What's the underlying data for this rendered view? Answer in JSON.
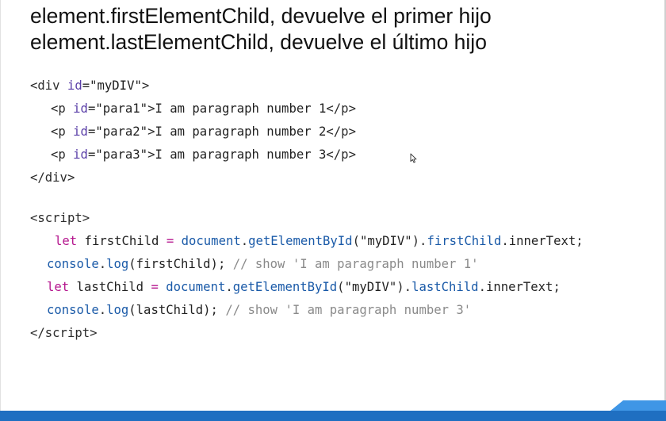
{
  "slide": {
    "title_lines": [
      "element.firstElementChild, devuelve el primer hijo",
      "element.lastElementChild, devuelve el último hijo"
    ]
  },
  "colors": {
    "punct": "#2b2b2b",
    "tag": "#2b2b2b",
    "attr": "#5a3fa8",
    "string": "#1f1f1f",
    "text": "#1f1f1f",
    "keyword": "#b5168e",
    "identifier": "#222222",
    "builtin": "#1a5aa8",
    "method": "#1a5aa8",
    "property": "#1a5aa8",
    "comment": "#8a8a8a",
    "bar": "#1f6fc1",
    "bar_accent": "#3f96e6"
  },
  "code_lines": [
    {
      "indent": 0,
      "tokens": [
        {
          "t": "<",
          "c": "punct"
        },
        {
          "t": "div",
          "c": "tag"
        },
        {
          "t": " ",
          "c": "text"
        },
        {
          "t": "id",
          "c": "attr"
        },
        {
          "t": "=",
          "c": "punct"
        },
        {
          "t": "\"myDIV\"",
          "c": "string"
        },
        {
          "t": ">",
          "c": "punct"
        }
      ]
    },
    {
      "indent": 1,
      "tokens": [
        {
          "t": "<",
          "c": "punct"
        },
        {
          "t": "p",
          "c": "tag"
        },
        {
          "t": " ",
          "c": "text"
        },
        {
          "t": "id",
          "c": "attr"
        },
        {
          "t": "=",
          "c": "punct"
        },
        {
          "t": "\"para1\"",
          "c": "string"
        },
        {
          "t": ">",
          "c": "punct"
        },
        {
          "t": "I am paragraph number 1",
          "c": "text"
        },
        {
          "t": "</",
          "c": "punct"
        },
        {
          "t": "p",
          "c": "tag"
        },
        {
          "t": ">",
          "c": "punct"
        }
      ]
    },
    {
      "indent": 1,
      "tokens": [
        {
          "t": "<",
          "c": "punct"
        },
        {
          "t": "p",
          "c": "tag"
        },
        {
          "t": " ",
          "c": "text"
        },
        {
          "t": "id",
          "c": "attr"
        },
        {
          "t": "=",
          "c": "punct"
        },
        {
          "t": "\"para2\"",
          "c": "string"
        },
        {
          "t": ">",
          "c": "punct"
        },
        {
          "t": "I am paragraph number 2",
          "c": "text"
        },
        {
          "t": "</",
          "c": "punct"
        },
        {
          "t": "p",
          "c": "tag"
        },
        {
          "t": ">",
          "c": "punct"
        }
      ]
    },
    {
      "indent": 1,
      "tokens": [
        {
          "t": "<",
          "c": "punct"
        },
        {
          "t": "p",
          "c": "tag"
        },
        {
          "t": " ",
          "c": "text"
        },
        {
          "t": "id",
          "c": "attr"
        },
        {
          "t": "=",
          "c": "punct"
        },
        {
          "t": "\"para3\"",
          "c": "string"
        },
        {
          "t": ">",
          "c": "punct"
        },
        {
          "t": "I am paragraph number 3",
          "c": "text"
        },
        {
          "t": "</",
          "c": "punct"
        },
        {
          "t": "p",
          "c": "tag"
        },
        {
          "t": ">",
          "c": "punct"
        }
      ]
    },
    {
      "indent": 0,
      "tokens": [
        {
          "t": "</",
          "c": "punct"
        },
        {
          "t": "div",
          "c": "tag"
        },
        {
          "t": ">",
          "c": "punct"
        }
      ]
    },
    {
      "indent": 0,
      "tokens": [
        {
          "t": "<",
          "c": "punct"
        },
        {
          "t": "script",
          "c": "tag"
        },
        {
          "t": ">",
          "c": "punct"
        }
      ]
    },
    {
      "indent": 3,
      "tokens": [
        {
          "t": "let",
          "c": "keyword"
        },
        {
          "t": " firstChild ",
          "c": "identifier"
        },
        {
          "t": "=",
          "c": "keyword"
        },
        {
          "t": " ",
          "c": "text"
        },
        {
          "t": "document",
          "c": "builtin"
        },
        {
          "t": ".",
          "c": "punct"
        },
        {
          "t": "getElementById",
          "c": "method"
        },
        {
          "t": "(",
          "c": "punct"
        },
        {
          "t": "\"myDIV\"",
          "c": "string"
        },
        {
          "t": ").",
          "c": "punct"
        },
        {
          "t": "firstChild",
          "c": "property"
        },
        {
          "t": ".",
          "c": "punct"
        },
        {
          "t": "innerText",
          "c": "identifier"
        },
        {
          "t": ";",
          "c": "punct"
        }
      ]
    },
    {
      "indent": 2,
      "tokens": [
        {
          "t": "console",
          "c": "builtin"
        },
        {
          "t": ".",
          "c": "punct"
        },
        {
          "t": "log",
          "c": "method"
        },
        {
          "t": "(firstChild); ",
          "c": "identifier"
        },
        {
          "t": "// show 'I am paragraph number 1'",
          "c": "comment"
        }
      ]
    },
    {
      "indent": 2,
      "tokens": [
        {
          "t": "let",
          "c": "keyword"
        },
        {
          "t": " lastChild ",
          "c": "identifier"
        },
        {
          "t": "=",
          "c": "keyword"
        },
        {
          "t": " ",
          "c": "text"
        },
        {
          "t": "document",
          "c": "builtin"
        },
        {
          "t": ".",
          "c": "punct"
        },
        {
          "t": "getElementById",
          "c": "method"
        },
        {
          "t": "(",
          "c": "punct"
        },
        {
          "t": "\"myDIV\"",
          "c": "string"
        },
        {
          "t": ").",
          "c": "punct"
        },
        {
          "t": "lastChild",
          "c": "property"
        },
        {
          "t": ".",
          "c": "punct"
        },
        {
          "t": "innerText",
          "c": "identifier"
        },
        {
          "t": ";",
          "c": "punct"
        }
      ]
    },
    {
      "indent": 2,
      "tokens": [
        {
          "t": "console",
          "c": "builtin"
        },
        {
          "t": ".",
          "c": "punct"
        },
        {
          "t": "log",
          "c": "method"
        },
        {
          "t": "(lastChild); ",
          "c": "identifier"
        },
        {
          "t": "// show 'I am paragraph number 3'",
          "c": "comment"
        }
      ]
    },
    {
      "indent": 0,
      "tokens": [
        {
          "t": "</",
          "c": "punct"
        },
        {
          "t": "script",
          "c": "tag"
        },
        {
          "t": ">",
          "c": "punct"
        }
      ]
    }
  ]
}
